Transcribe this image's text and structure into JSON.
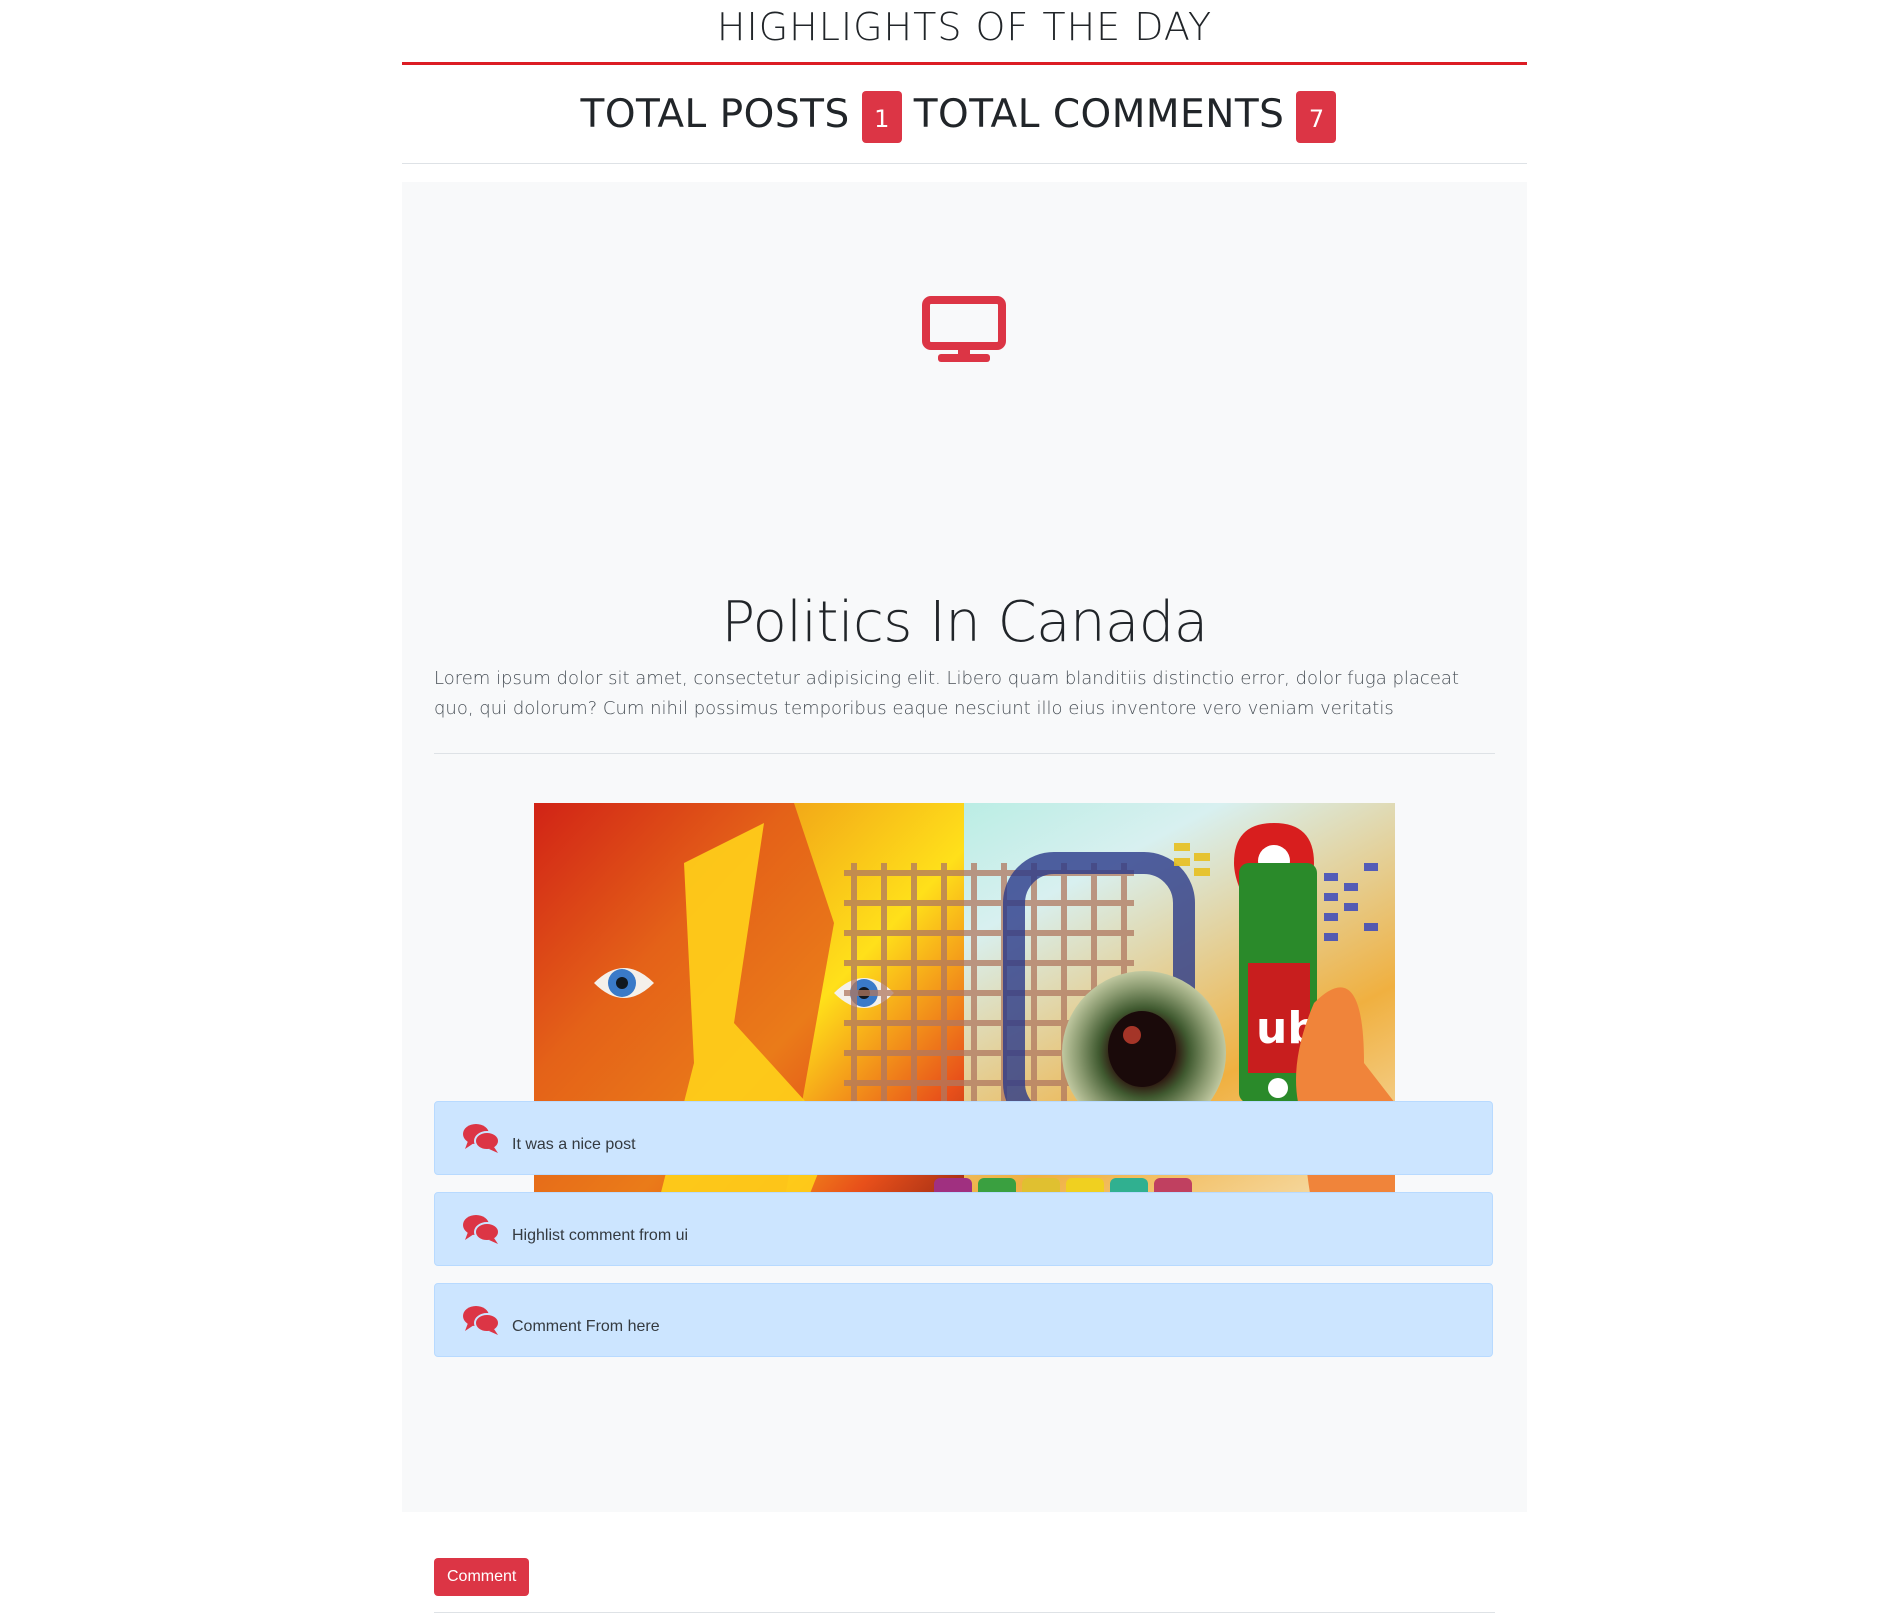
{
  "header": {
    "title": "HIGHLIGHTS OF THE DAY",
    "accent_color": "#dc1c24"
  },
  "stats": {
    "posts_label": "TOTAL POSTS",
    "posts_count": "1",
    "comments_label": "TOTAL COMMENTS",
    "comments_count": "7",
    "badge_color": "#dc3545"
  },
  "post": {
    "icon": "monitor-icon",
    "title": "Politics In Canada",
    "body": "Lorem ipsum dolor sit amet, consectetur adipisicing elit. Libero quam blanditiis distinctio error, dolor fuga placeat quo, qui dolorum? Cum nihil possimus temporibus eaque nesciunt illo eius inventore vero veniam veritatis",
    "image_description_icon": "post-image"
  },
  "comments": [
    {
      "icon": "comments-icon",
      "text": "It was a nice post"
    },
    {
      "icon": "comments-icon",
      "text": "Highlist comment from ui"
    },
    {
      "icon": "comments-icon",
      "text": "Comment From here"
    }
  ],
  "actions": {
    "comment_button": "Comment"
  }
}
